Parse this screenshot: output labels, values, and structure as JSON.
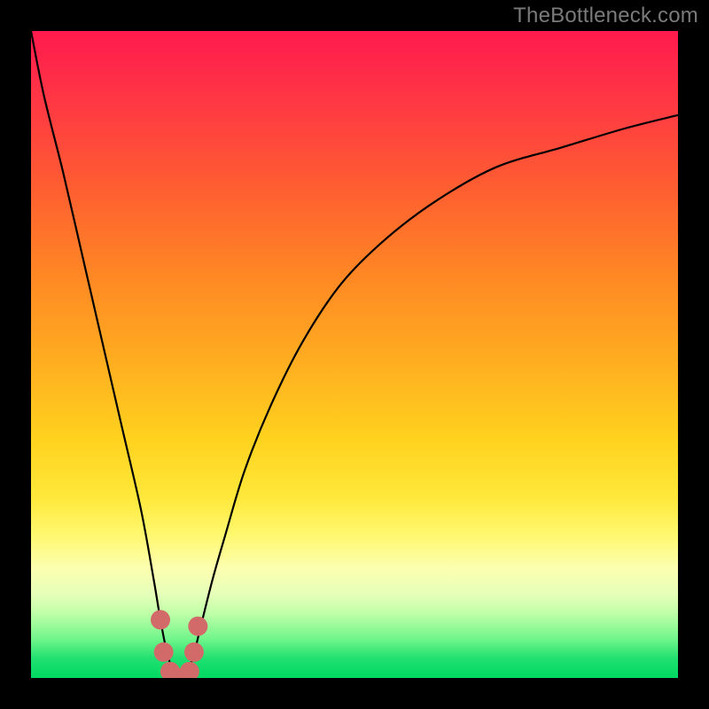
{
  "watermark": "TheBottleneck.com",
  "chart_data": {
    "type": "line",
    "title": "",
    "xlabel": "",
    "ylabel": "",
    "xlim": [
      0,
      100
    ],
    "ylim": [
      0,
      100
    ],
    "series": [
      {
        "name": "bottleneck-curve",
        "x": [
          0,
          2,
          5,
          8,
          11,
          14,
          17,
          19,
          20,
          21,
          22,
          23,
          24,
          25,
          26,
          28,
          30,
          33,
          37,
          42,
          48,
          55,
          63,
          72,
          82,
          92,
          100
        ],
        "values": [
          100,
          90,
          78,
          65,
          52,
          39,
          26,
          15,
          9,
          4,
          1,
          0,
          1,
          3,
          7,
          15,
          22,
          32,
          42,
          52,
          61,
          68,
          74,
          79,
          82,
          85,
          87
        ]
      }
    ],
    "markers": {
      "name": "highlight-dots",
      "color": "#d36a6a",
      "points": [
        {
          "x": 20.0,
          "y": 9
        },
        {
          "x": 20.5,
          "y": 4
        },
        {
          "x": 21.5,
          "y": 1
        },
        {
          "x": 23.0,
          "y": 0
        },
        {
          "x": 24.5,
          "y": 1
        },
        {
          "x": 25.2,
          "y": 4
        },
        {
          "x": 25.8,
          "y": 8
        }
      ]
    },
    "gradient_stops": [
      {
        "pos": 0,
        "color": "#ff1a4d"
      },
      {
        "pos": 50,
        "color": "#ffb020"
      },
      {
        "pos": 80,
        "color": "#fcffb0"
      },
      {
        "pos": 100,
        "color": "#00d862"
      }
    ]
  },
  "interactable_regions": []
}
